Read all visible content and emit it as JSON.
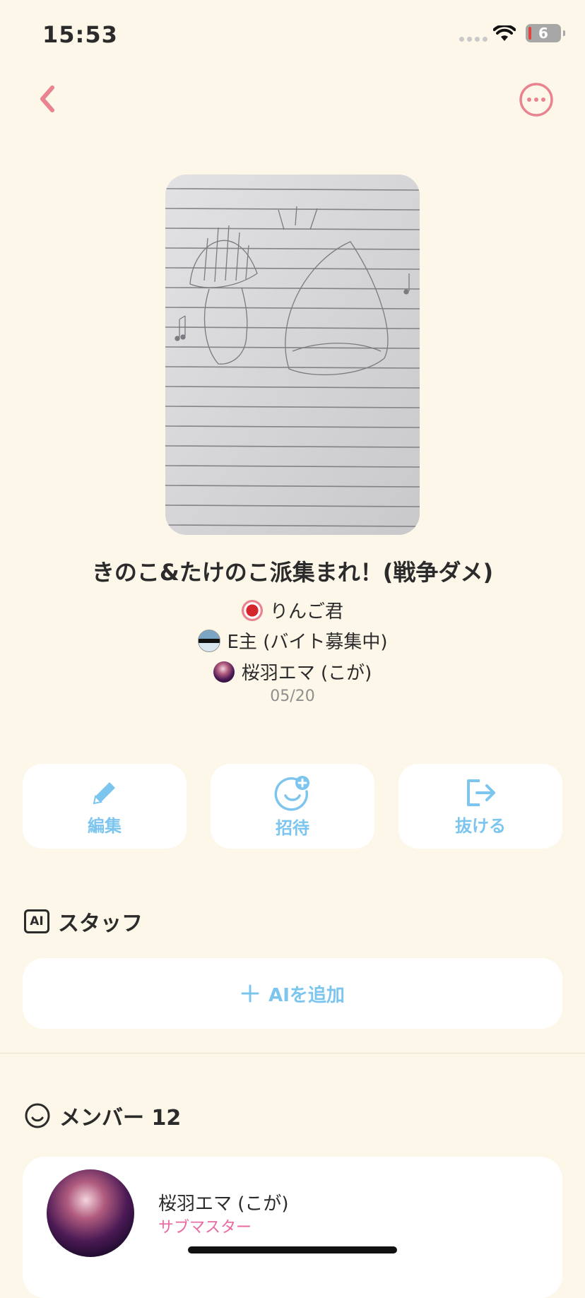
{
  "status_bar": {
    "time": "15:53",
    "battery": "6"
  },
  "group": {
    "title": "きのこ&たけのこ派集まれ！(戦争ダメ)",
    "members_preview": [
      {
        "name": "りんご君",
        "avatar_color": "#d4262b"
      },
      {
        "name": "E主 (バイト募集中)",
        "avatar_color": "#3b6d8e"
      },
      {
        "name": "桜羽エマ (こが)",
        "avatar_color": "#5a2a5f"
      }
    ],
    "date": "05/20"
  },
  "actions": {
    "edit": "編集",
    "invite": "招待",
    "leave": "抜ける"
  },
  "staff": {
    "header": "スタッフ",
    "badge": "AI",
    "add_label": "AIを追加"
  },
  "members": {
    "header": "メンバー 12",
    "list": [
      {
        "name": "桜羽エマ (こが)",
        "role": "サブマスター"
      }
    ]
  },
  "colors": {
    "accent_pink": "#e8838f",
    "accent_blue": "#7cc5ee",
    "background": "#fdf7e9",
    "role_pink": "#e86aa0"
  }
}
